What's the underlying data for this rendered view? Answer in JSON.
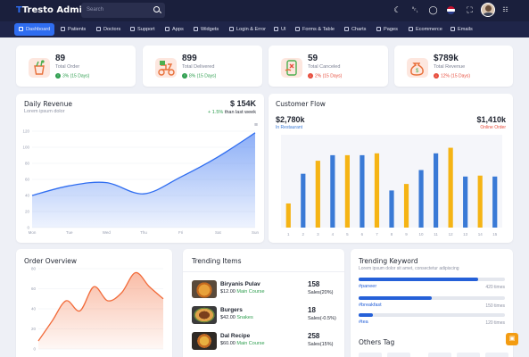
{
  "header": {
    "logo": "Tresto Admin",
    "search_placeholder": "Search",
    "icons": [
      "moon-icon",
      "bell-icon",
      "chat-icon",
      "flag-icon",
      "fullscreen-icon",
      "apps-icon"
    ]
  },
  "nav": [
    {
      "label": "Dashboard",
      "active": true
    },
    {
      "label": "Patients"
    },
    {
      "label": "Doctors"
    },
    {
      "label": "Support"
    },
    {
      "label": "Apps"
    },
    {
      "label": "Widgets"
    },
    {
      "label": "Login & Error"
    },
    {
      "label": "UI"
    },
    {
      "label": "Forms & Table"
    },
    {
      "label": "Charts"
    },
    {
      "label": "Pages"
    },
    {
      "label": "Ecommerce"
    },
    {
      "label": "Emails"
    }
  ],
  "stats": [
    {
      "value": "89",
      "label": "Total Order",
      "delta": "3% (15 Days)",
      "color": "#2e9e4f",
      "icon": "food-bag-icon"
    },
    {
      "value": "899",
      "label": "Total Delivered",
      "delta": "8% (15 Days)",
      "color": "#2e9e4f",
      "icon": "delivery-scooter-icon"
    },
    {
      "value": "59",
      "label": "Total Canceled",
      "delta": "2% (15 Days)",
      "color": "#e74c3c",
      "icon": "canceled-order-icon"
    },
    {
      "value": "$789k",
      "label": "Total Revenue",
      "delta": "12% (15 Days)",
      "color": "#e74c3c",
      "icon": "money-bag-icon"
    }
  ],
  "daily_revenue": {
    "title": "Daily Revenue",
    "subtitle": "Lorem ipsum dolor",
    "amount": "$ 154K",
    "change": "+ 1.5%",
    "change_suffix": "than last week"
  },
  "customer_flow": {
    "title": "Customer Flow",
    "left_value": "$2,780k",
    "left_label": "In Restaurant",
    "right_value": "$1,410k",
    "right_label": "Online Order"
  },
  "order_overview": {
    "title": "Order Overview"
  },
  "trending_items": {
    "title": "Trending Items",
    "items": [
      {
        "name": "Biryanis Pulav",
        "price": "$12.00",
        "category": "Main Course",
        "count": "158",
        "sales": "Sales(20%)"
      },
      {
        "name": "Burgers",
        "price": "$42.00",
        "category": "Snakes",
        "count": "18",
        "sales": "Sales(-0.5%)"
      },
      {
        "name": "Dal Recipe",
        "price": "$60.00",
        "category": "Main Course",
        "count": "258",
        "sales": "Sales(15%)"
      }
    ]
  },
  "trending_keyword": {
    "title": "Trending Keyword",
    "subtitle": "Lorem ipsum dolor sit amet, consectetur adipiscing",
    "keywords": [
      {
        "tag": "#paneer",
        "count": "420 times",
        "level": 0.82
      },
      {
        "tag": "#breakfast",
        "count": "150 times",
        "level": 0.5
      },
      {
        "tag": "#tea",
        "count": "120 times",
        "level": 0.1
      }
    ],
    "other_tags_title": "Others Tag"
  },
  "chart_data": [
    {
      "type": "area",
      "categories": [
        "Mon",
        "Tue",
        "Wed",
        "Thu",
        "Fri",
        "Sat",
        "Sun"
      ],
      "values": [
        40,
        52,
        56,
        42,
        63,
        88,
        118
      ],
      "ylim": [
        0,
        120
      ],
      "yticks": [
        0,
        20,
        40,
        60,
        80,
        100,
        120
      ],
      "color": "#2f6df0"
    },
    {
      "type": "bar",
      "categories": [
        "1",
        "2",
        "3",
        "4",
        "5",
        "6",
        "7",
        "8",
        "9",
        "10",
        "11",
        "12",
        "13",
        "14",
        "15"
      ],
      "series": [
        {
          "name": "In Restaurant",
          "color": "#3a7ad6",
          "values": [
            0,
            58,
            0,
            78,
            0,
            78,
            0,
            40,
            0,
            0,
            80,
            0,
            0,
            0,
            55
          ]
        },
        {
          "name": "Online Order",
          "color": "#f5b415",
          "values": [
            26,
            0,
            72,
            0,
            78,
            0,
            80,
            0,
            47,
            0,
            0,
            86,
            0,
            56,
            0
          ]
        }
      ],
      "extra_blue": {
        "positions": [
          10,
          11,
          13
        ],
        "values": [
          62,
          0,
          55
        ]
      }
    },
    {
      "type": "area",
      "values": [
        8,
        28,
        48,
        38,
        62,
        48,
        56,
        76,
        62,
        50
      ],
      "ylim": [
        0,
        80
      ],
      "yticks": [
        0,
        20,
        40,
        60,
        80
      ],
      "color": "#f26b3a"
    }
  ]
}
